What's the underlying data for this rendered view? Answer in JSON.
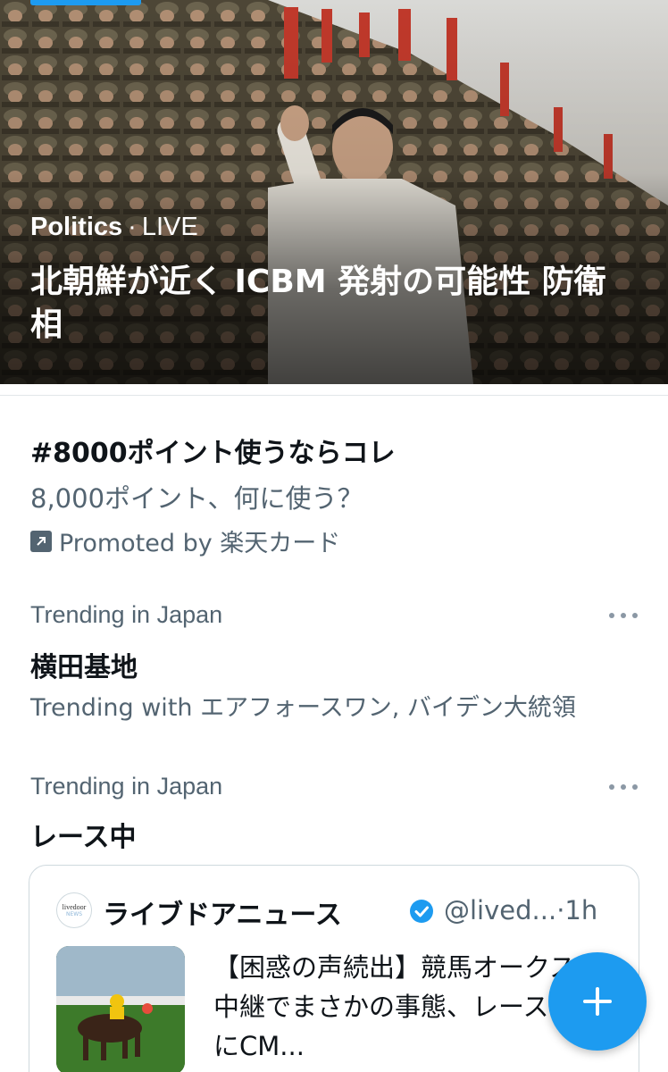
{
  "hero": {
    "category": "Politics",
    "separator": "·",
    "status": "LIVE",
    "title": "北朝鮮が近く ICBM 発射の可能性 防衛相"
  },
  "promoted": {
    "hashtag": "#8000ポイント使うならコレ",
    "description": "8,000ポイント、何に使う？",
    "promoted_by": "Promoted by 楽天カード",
    "icon": "promoted-arrow-icon"
  },
  "trends": [
    {
      "context": "Trending in Japan",
      "name": "横田基地",
      "trending_with": "Trending with エアフォースワン, バイデン大統領"
    },
    {
      "context": "Trending in Japan",
      "name": "レース中"
    }
  ],
  "tweet_card": {
    "avatar_line1": "livedoor",
    "avatar_line2": "NEWS",
    "name": "ライブドアニュース",
    "handle": "@lived...",
    "time": "·1h",
    "text": "【困惑の声続出】競馬オークス中継でまさかの事態、レース中にCM...",
    "verified_color": "#1d9bf0"
  },
  "fab": {
    "icon": "plus-icon",
    "color": "#1d9bf0"
  },
  "colors": {
    "accent": "#1d9bf0",
    "secondary_text": "#536471"
  }
}
